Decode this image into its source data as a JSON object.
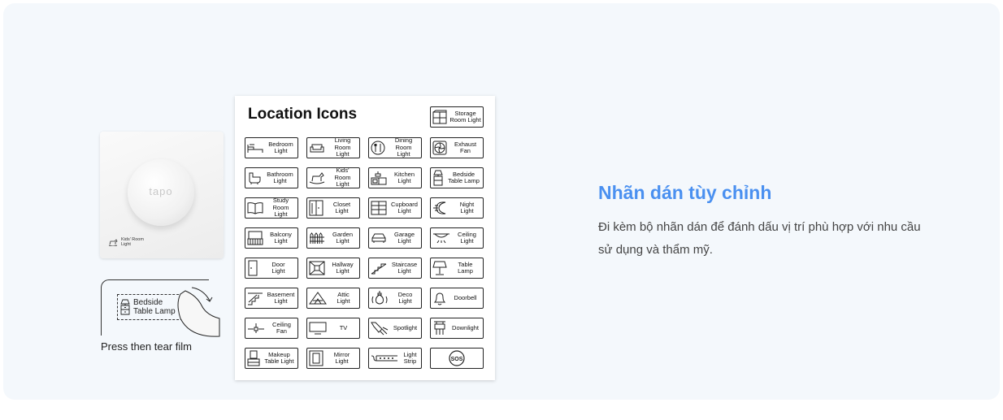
{
  "device": {
    "brand": "tapo",
    "sticker_label": "Kids' Room\nLight"
  },
  "tear": {
    "sticker_label": "Bedside\nTable Lamp",
    "caption": "Press then tear film"
  },
  "sheet": {
    "title": "Location Icons",
    "tiles": [
      {
        "label": "Storage\nRoom Light",
        "icon": "storage-icon"
      },
      {
        "label": "Bedroom\nLight",
        "icon": "bed-icon"
      },
      {
        "label": "Living Room\nLight",
        "icon": "sofa-icon"
      },
      {
        "label": "Dining Room\nLight",
        "icon": "dining-icon"
      },
      {
        "label": "Exhaust\nFan",
        "icon": "fan-icon"
      },
      {
        "label": "Bathroom\nLight",
        "icon": "bathtub-icon"
      },
      {
        "label": "Kids' Room\nLight",
        "icon": "rocking-horse-icon"
      },
      {
        "label": "Kitchen\nLight",
        "icon": "kitchen-icon"
      },
      {
        "label": "Bedside\nTable Lamp",
        "icon": "bedside-lamp-icon"
      },
      {
        "label": "Study Room\nLight",
        "icon": "book-icon"
      },
      {
        "label": "Closet\nLight",
        "icon": "closet-icon"
      },
      {
        "label": "Cupboard\nLight",
        "icon": "cupboard-icon"
      },
      {
        "label": "Night\nLight",
        "icon": "moon-icon"
      },
      {
        "label": "Balcony\nLight",
        "icon": "balcony-icon"
      },
      {
        "label": "Garden\nLight",
        "icon": "fence-icon"
      },
      {
        "label": "Garage\nLight",
        "icon": "car-icon"
      },
      {
        "label": "Ceiling\nLight",
        "icon": "ceiling-light-icon"
      },
      {
        "label": "Door\nLight",
        "icon": "door-icon"
      },
      {
        "label": "Hallway\nLight",
        "icon": "hallway-icon"
      },
      {
        "label": "Staircase\nLight",
        "icon": "stairs-icon"
      },
      {
        "label": "Table\nLamp",
        "icon": "table-lamp-icon"
      },
      {
        "label": "Basement\nLight",
        "icon": "basement-icon"
      },
      {
        "label": "Attic\nLight",
        "icon": "attic-icon"
      },
      {
        "label": "Deco\nLight",
        "icon": "deco-bulb-icon"
      },
      {
        "label": "Doorbell",
        "icon": "bell-icon"
      },
      {
        "label": "Ceiling\nFan",
        "icon": "ceiling-fan-icon"
      },
      {
        "label": "TV",
        "icon": "tv-icon"
      },
      {
        "label": "Spotlight",
        "icon": "spotlight-icon"
      },
      {
        "label": "Downlight",
        "icon": "downlight-icon"
      },
      {
        "label": "Makeup\nTable Light",
        "icon": "makeup-mirror-icon"
      },
      {
        "label": "Mirror\nLight",
        "icon": "mirror-icon"
      },
      {
        "label": "Light\nStrip",
        "icon": "light-strip-icon"
      },
      {
        "label": "",
        "icon": "sos-icon",
        "text": "SOS"
      }
    ]
  },
  "feature": {
    "headline": "Nhãn dán tùy chỉnh",
    "description": "Đi kèm bộ nhãn dán để đánh dấu vị trí phù hợp với nhu cầu sử dụng và thẩm mỹ."
  }
}
